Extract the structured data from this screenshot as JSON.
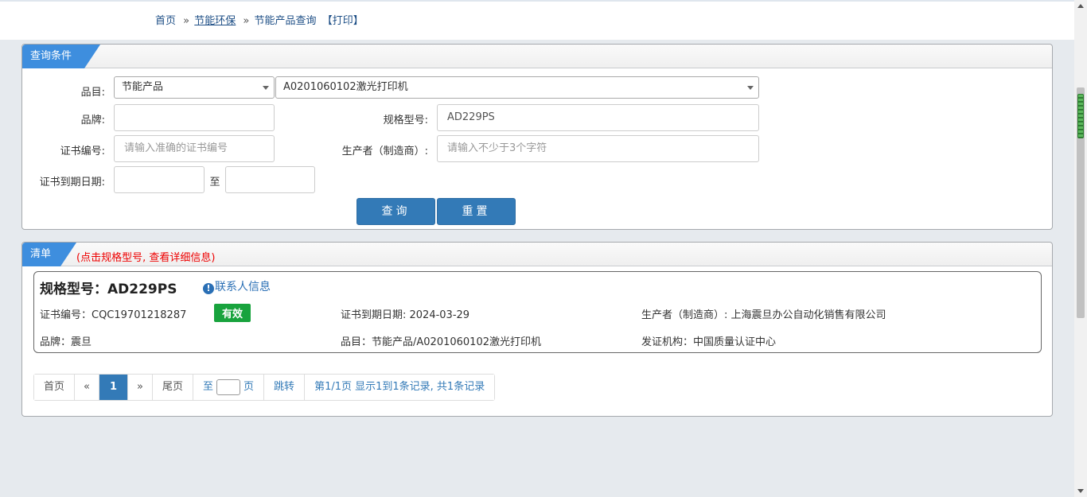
{
  "breadcrumb": {
    "home": "首页",
    "sep1": "»",
    "section": "节能环保",
    "sep2": "»",
    "current": "节能产品查询",
    "print": "【打印】"
  },
  "query_panel": {
    "title": "查询条件",
    "category_label": "品目:",
    "category_value": "节能产品",
    "subcategory_value": "A0201060102激光打印机",
    "brand_label": "品牌:",
    "brand_value": "",
    "model_label": "规格型号:",
    "model_value": "AD229PS",
    "cert_label": "证书编号:",
    "cert_placeholder": "请输入准确的证书编号",
    "maker_label": "生产者（制造商）:",
    "maker_placeholder": "请输入不少于3个字符",
    "expiry_label": "证书到期日期:",
    "expiry_to": "至",
    "search_button": "查询",
    "reset_button": "重置"
  },
  "list_panel": {
    "title": "清单",
    "note": "(点击规格型号, 查看详细信息)",
    "item": {
      "model_heading": "规格型号：AD229PS",
      "contact_link": "联系人信息",
      "cert_no": "证书编号：CQC19701218287",
      "status": "有效",
      "expiry": "证书到期日期: 2024-03-29",
      "maker": "生产者（制造商）: 上海震旦办公自动化销售有限公司",
      "brand": "品牌：震旦",
      "category": "品目：节能产品/A0201060102激光打印机",
      "issuer": "发证机构：中国质量认证中心"
    }
  },
  "pagination": {
    "first": "首页",
    "prev": "«",
    "current": "1",
    "next": "»",
    "last": "尾页",
    "to": "至",
    "page_unit": "页",
    "jump": "跳转",
    "summary": "第1/1页  显示1到1条记录, 共1条记录"
  },
  "colors": {
    "accent": "#3e8ede",
    "button": "#337ab7",
    "valid_badge": "#18a33d",
    "note": "#e00000"
  }
}
